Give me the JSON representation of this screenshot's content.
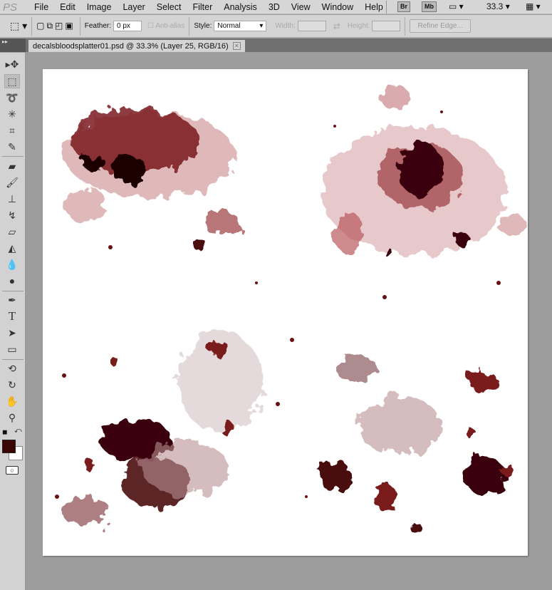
{
  "app": {
    "logo": "PS",
    "menu": [
      "File",
      "Edit",
      "Image",
      "Layer",
      "Select",
      "Filter",
      "Analysis",
      "3D",
      "View",
      "Window",
      "Help"
    ],
    "bridge": "Br",
    "mini_bridge": "Mb",
    "zoom": "33.3"
  },
  "options": {
    "feather_label": "Feather:",
    "feather_value": "0 px",
    "antialias": "Anti-alias",
    "style_label": "Style:",
    "style_value": "Normal",
    "width_label": "Width:",
    "height_label": "Height:",
    "refine_edge": "Refine Edge..."
  },
  "document": {
    "tab_title": "decalsbloodsplatter01.psd @ 33.3% (Layer 25, RGB/16)",
    "close": "×"
  },
  "colors": {
    "foreground": "#3a0505",
    "background": "#ffffff",
    "blood_dark": "#4a0a0e",
    "blood": "#7a1a1e",
    "blood_light": "#c9888c"
  }
}
